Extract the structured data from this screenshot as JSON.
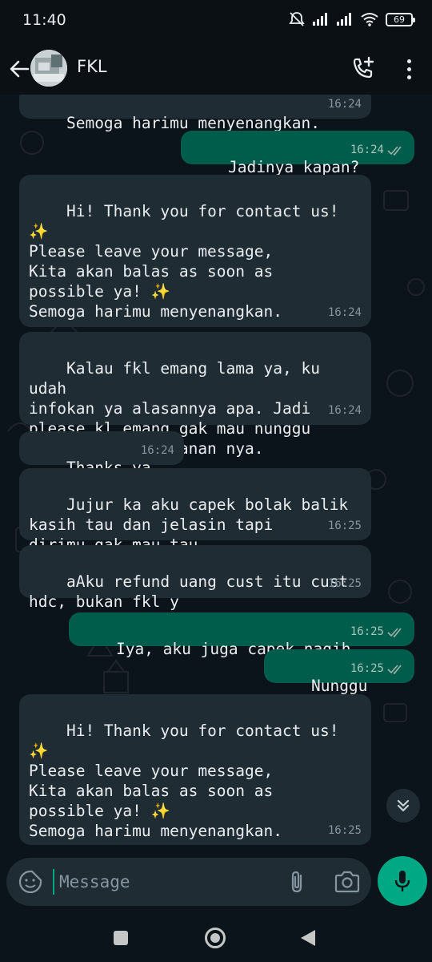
{
  "status_bar": {
    "time": "11:40",
    "battery": "69",
    "icons": [
      "mute-icon",
      "signal-icon",
      "signal-icon",
      "wifi-icon",
      "battery-icon"
    ]
  },
  "header": {
    "chat_name": "FKL",
    "icons": [
      "back-arrow-icon",
      "avatar",
      "add-call-icon",
      "more-vert-icon"
    ]
  },
  "messages": [
    {
      "direction": "in",
      "text": "Semoga harimu menyenangkan.",
      "time": "16:24"
    },
    {
      "direction": "out",
      "text": "Jadinya kapan?",
      "time": "16:24",
      "status": "read"
    },
    {
      "direction": "in",
      "text": "Hi! Thank you for contact us!\n✨\nPlease leave your message,\nKita akan balas as soon as\npossible ya! ✨\nSemoga harimu menyenangkan.",
      "time": "16:24"
    },
    {
      "direction": "in",
      "text": "Kalau fkl emang lama ya, ku udah\ninfokan ya alasannya apa. Jadi\nplease kl emang gak mau nunggu\ndi klaim aja pesanan nya.",
      "time": "16:24"
    },
    {
      "direction": "in",
      "text": "Thanks ya",
      "time": "16:24"
    },
    {
      "direction": "in",
      "text": "Jujur ka aku capek bolak balik\nkasih tau dan jelasin tapi\ndirimu gak mau tau.",
      "time": "16:25"
    },
    {
      "direction": "in",
      "text": "aAku refund uang cust itu cust\nhdc, bukan fkl y",
      "time": "16:25"
    },
    {
      "direction": "out",
      "text": "Iya, aku juga capek nagih",
      "time": "16:25",
      "status": "read"
    },
    {
      "direction": "out",
      "text": "Nunggu",
      "time": "16:25",
      "status": "read"
    },
    {
      "direction": "in",
      "text": "Hi! Thank you for contact us!\n✨\nPlease leave your message,\nKita akan balas as soon as\npossible ya! ✨\nSemoga harimu menyenangkan.",
      "time": "16:25"
    }
  ],
  "input": {
    "placeholder": "Message",
    "icons": [
      "sticker-icon",
      "attach-icon",
      "camera-icon",
      "mic-icon"
    ]
  },
  "scroll_button_icon": "double-chevron-down-icon",
  "nav_bar": {
    "icons": [
      "recents-icon",
      "home-icon",
      "back-icon"
    ]
  },
  "colors": {
    "background": "#0b141a",
    "incoming_bubble": "#1f2c34",
    "outgoing_bubble": "#005c4b",
    "accent": "#00a884",
    "timestamp": "#8696a0"
  }
}
